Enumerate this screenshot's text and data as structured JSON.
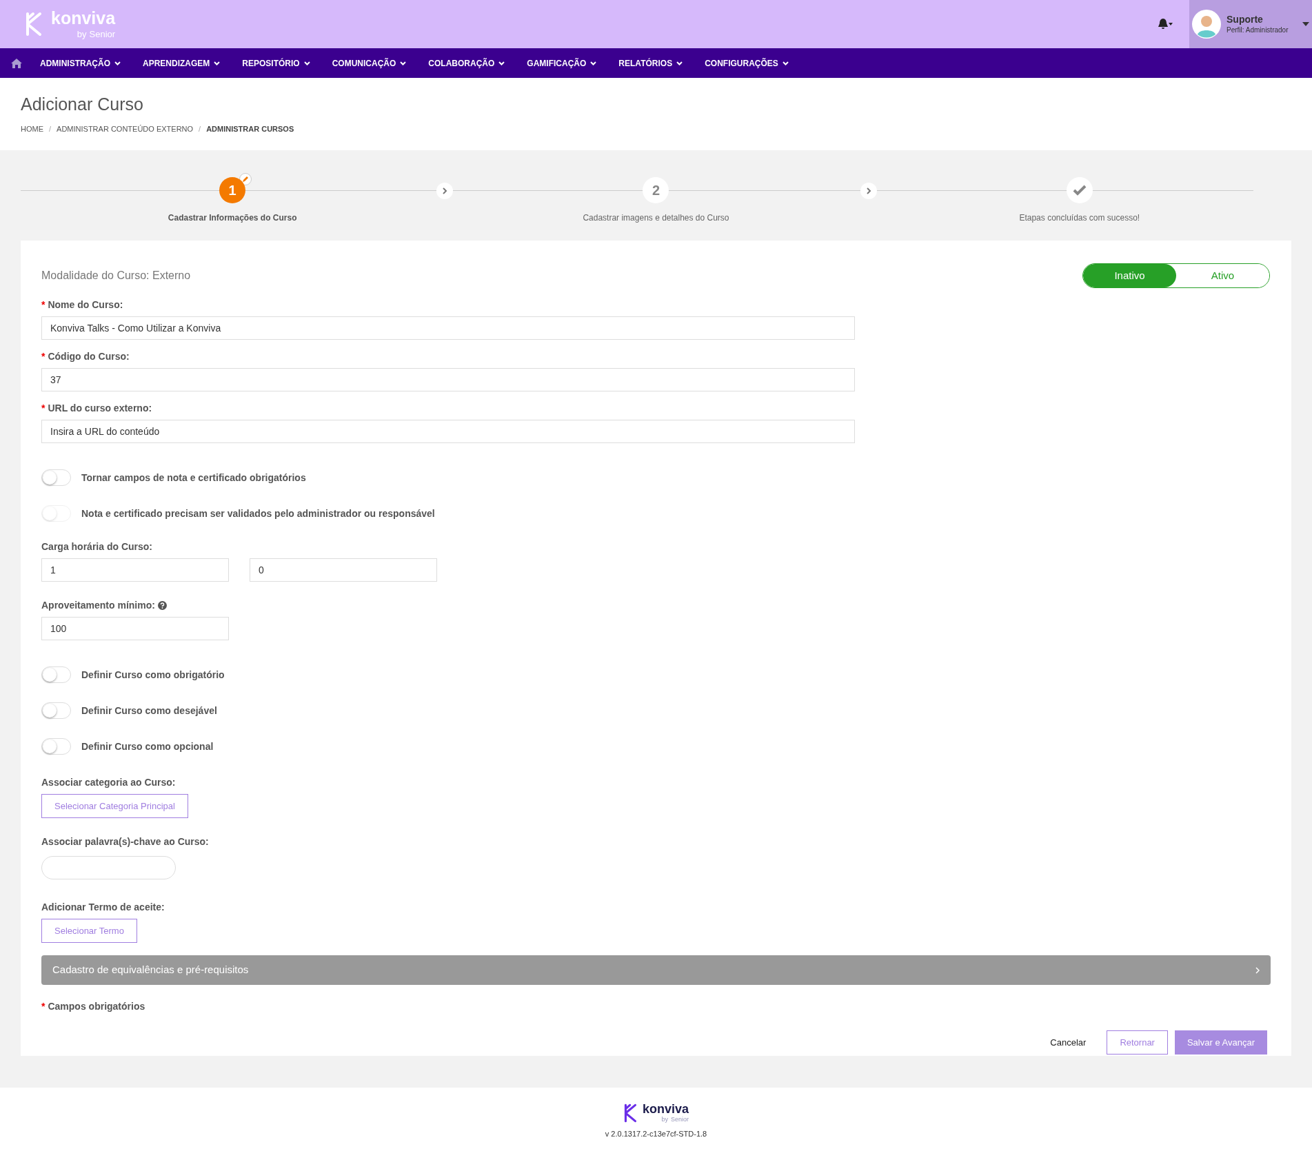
{
  "header": {
    "logo_text": "konviva",
    "logo_sub": "by",
    "logo_sub_brand": "Senior",
    "user": {
      "name": "Suporte",
      "profile": "Perfil: Administrador"
    }
  },
  "nav": [
    {
      "label": "ADMINISTRAÇÃO"
    },
    {
      "label": "APRENDIZAGEM"
    },
    {
      "label": "REPOSITÓRIO"
    },
    {
      "label": "COMUNICAÇÃO"
    },
    {
      "label": "COLABORAÇÃO"
    },
    {
      "label": "GAMIFICAÇÃO"
    },
    {
      "label": "RELATÓRIOS"
    },
    {
      "label": "CONFIGURAÇÕES"
    }
  ],
  "page_title": "Adicionar Curso",
  "breadcrumb_separator": "/",
  "breadcrumb": [
    {
      "label": "HOME",
      "selected": false
    },
    {
      "label": "ADMINISTRAR CONTEÚDO EXTERNO",
      "selected": false
    },
    {
      "label": "ADMINISTRAR CURSOS",
      "selected": true
    }
  ],
  "steps": [
    {
      "kind": "number",
      "marker": "1",
      "label": "Cadastrar Informações do Curso",
      "selected": true
    },
    {
      "kind": "number",
      "marker": "2",
      "label": "Cadastrar imagens e detalhes do Curso",
      "selected": false
    },
    {
      "kind": "check",
      "label": "Etapas concluídas com sucesso!",
      "selected": false
    }
  ],
  "form": {
    "required_mark": "*",
    "modality": "Modalidade do Curso: Externo",
    "status": [
      {
        "label": "Inativo",
        "selected": true
      },
      {
        "label": "Ativo",
        "selected": false
      }
    ],
    "fields": [
      {
        "kind": "text",
        "required": true,
        "label": "Nome do Curso:",
        "value": "Konviva Talks - Como Utilizar a Konviva"
      },
      {
        "kind": "text",
        "required": true,
        "label": "Código do Curso:",
        "value": "37"
      },
      {
        "kind": "text",
        "required": true,
        "label": "URL do curso externo:",
        "value": "Insira a URL do conteúdo"
      },
      {
        "kind": "toggle",
        "label": "Tornar campos de nota e certificado obrigatórios",
        "on": false,
        "disabled": false
      },
      {
        "kind": "toggle",
        "label": "Nota e certificado precisam ser validados pelo administrador ou responsável",
        "on": false,
        "disabled": true
      },
      {
        "kind": "pair",
        "required": false,
        "label": "Carga horária do Curso:",
        "values": [
          "1",
          "0"
        ]
      },
      {
        "kind": "short",
        "required": false,
        "help": true,
        "label": "Aproveitamento mínimo:",
        "value": "100"
      },
      {
        "kind": "toggle",
        "label": "Definir Curso como obrigatório",
        "on": false,
        "disabled": false
      },
      {
        "kind": "toggle",
        "label": "Definir Curso como desejável",
        "on": false,
        "disabled": false
      },
      {
        "kind": "toggle",
        "label": "Definir Curso como opcional",
        "on": false,
        "disabled": false
      },
      {
        "kind": "button",
        "required": false,
        "label": "Associar categoria ao Curso:",
        "button": "Selecionar Categoria Principal"
      },
      {
        "kind": "tags",
        "required": false,
        "label": "Associar palavra(s)-chave ao Curso:"
      },
      {
        "kind": "button",
        "required": false,
        "label": "Adicionar Termo de aceite:",
        "button": "Selecionar Termo"
      }
    ],
    "accordion": "Cadastro de equivalências e pré-requisitos",
    "required_note": "Campos obrigatórios",
    "actions": [
      {
        "kind": "link",
        "label": "Cancelar"
      },
      {
        "kind": "outline",
        "label": "Retornar"
      },
      {
        "kind": "primary",
        "label": "Salvar e Avançar"
      }
    ]
  },
  "footer": {
    "logo_text": "konviva",
    "logo_sub": "by",
    "logo_sub_brand": "Senior",
    "version": "v 2.0.1317.2-c13e7cf-STD-1.8"
  }
}
